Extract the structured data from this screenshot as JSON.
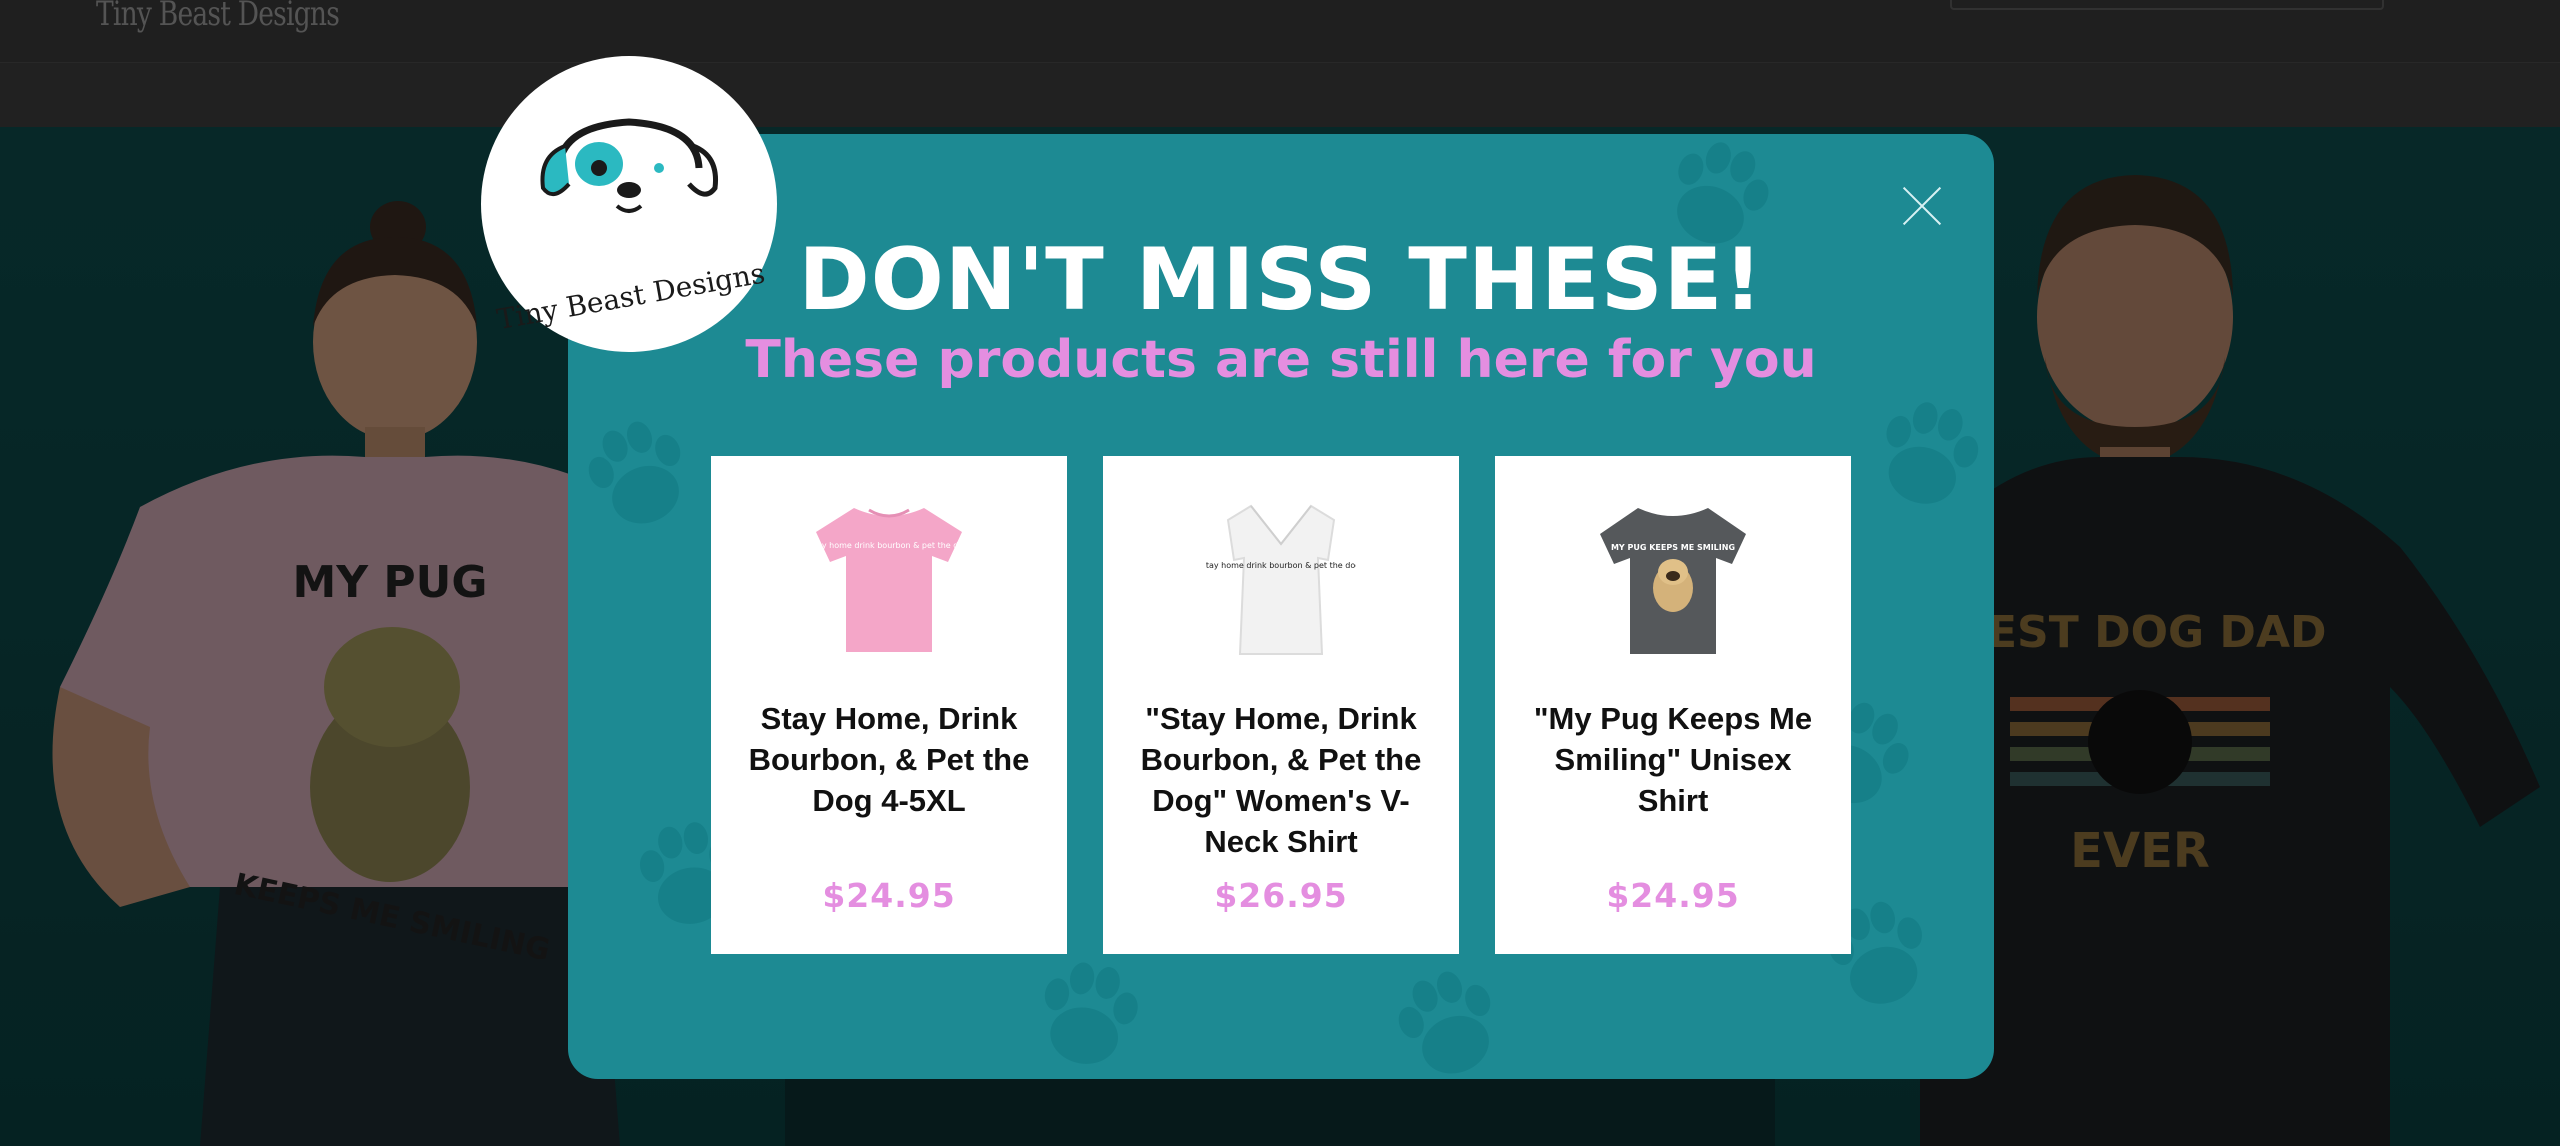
{
  "site": {
    "logo_text": "Tiny Beast Designs"
  },
  "hero": {
    "woman_shirt_line1": "MY PUG",
    "woman_shirt_line2": "KEEPS ME SMILING",
    "man_shirt_line1": "BEST DOG DAD",
    "man_shirt_line2": "EVER"
  },
  "modal": {
    "logo_text": "Tiny Beast Designs",
    "title": "DON'T MISS THESE!",
    "subtitle": "These products are still here for you",
    "products": [
      {
        "name": "Stay Home, Drink Bourbon, & Pet the Dog 4-5XL",
        "price": "$24.95",
        "image": "pink-tshirt",
        "shirt_text": "stay home drink bourbon & pet the dog"
      },
      {
        "name": "\"Stay Home, Drink Bourbon, & Pet the Dog\" Women's V-Neck Shirt",
        "price": "$26.95",
        "image": "white-vneck-shirt",
        "shirt_text": "stay home drink bourbon & pet the dog"
      },
      {
        "name": "\"My Pug Keeps Me Smiling\" Unisex Shirt",
        "price": "$24.95",
        "image": "gray-pug-shirt",
        "shirt_text": "MY PUG KEEPS ME SMILING"
      }
    ]
  },
  "colors": {
    "modal_bg": "#1d8a93",
    "accent_pink": "#e48ee0",
    "title_white": "#ffffff"
  }
}
